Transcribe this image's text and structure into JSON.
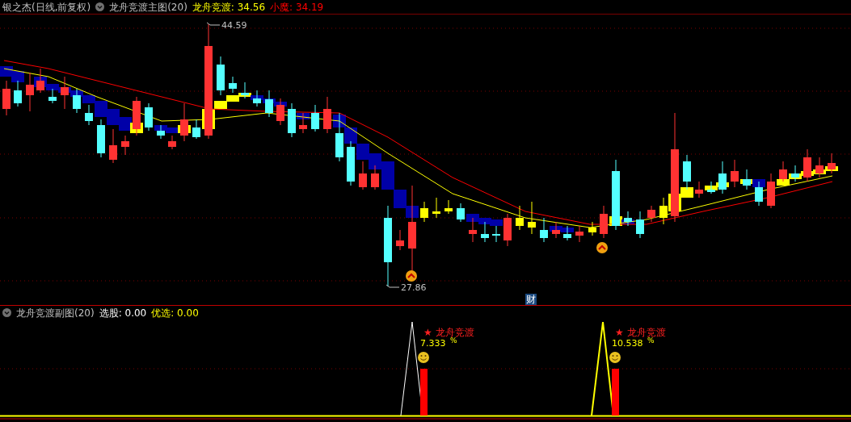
{
  "main_chart": {
    "stock": "银之杰(日线,前复权)",
    "indicator": "龙舟竞渡主图(20)",
    "readings": [
      {
        "label": "龙舟竞渡:",
        "value": "34.56",
        "color": "#ffff00"
      },
      {
        "label": "小魔:",
        "value": "34.19",
        "color": "#ff0000"
      }
    ],
    "high_label": "44.59",
    "low_label": "27.86",
    "badge": "财"
  },
  "sub_chart": {
    "indicator": "龙舟竞渡副图(20)",
    "readings": [
      {
        "label": "选股:",
        "value": "0.00",
        "color": "#ffffff"
      },
      {
        "label": "优选:",
        "value": "0.00",
        "color": "#ffff00"
      }
    ],
    "signals": [
      {
        "title": "★ 龙舟竞渡",
        "value": "7.333",
        "unit": "%"
      },
      {
        "title": "★ 龙舟竞渡",
        "value": "10.538",
        "unit": "%"
      }
    ]
  }
}
